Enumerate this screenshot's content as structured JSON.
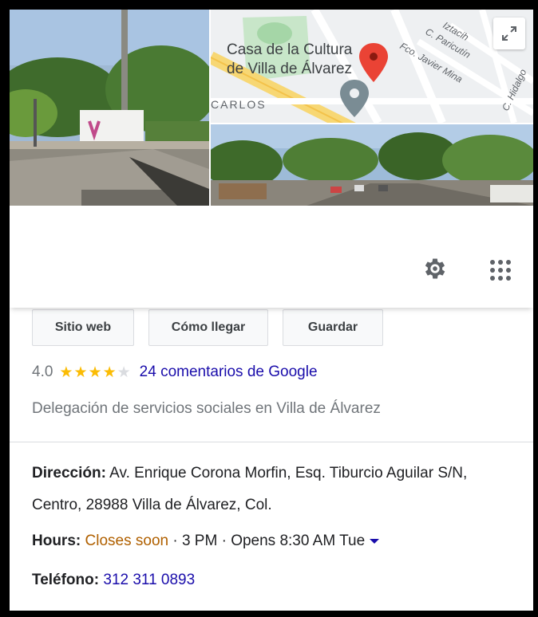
{
  "map": {
    "place_label_line1": "Casa de la Cultura",
    "place_label_line2": "de Villa de Álvarez",
    "street_carlos": "CARLOS",
    "street_iztacihuatl": "Iztacih",
    "street_paricutin": "C. Paricutín",
    "street_javier_mina": "Fco. Javier Mina",
    "street_hidalgo": "C. Hidalgo"
  },
  "actions": [
    {
      "label": "Sitio web"
    },
    {
      "label": "Cómo llegar"
    },
    {
      "label": "Guardar"
    }
  ],
  "rating": {
    "value": "4.0",
    "stars_filled": 4,
    "stars_total": 5,
    "reviews_text": "24 comentarios de Google"
  },
  "category": "Delegación de servicios sociales en Villa de Álvarez",
  "address": {
    "label": "Dirección:",
    "value": "Av. Enrique Corona Morfin, Esq. Tiburcio Aguilar S/N, Centro, 28988 Villa de Álvarez, Col."
  },
  "hours": {
    "label": "Hours:",
    "status": "Closes soon",
    "close_time": " · 3 PM · Opens 8:30 AM Tue"
  },
  "phone": {
    "label": "Teléfono:",
    "value": "312 311 0893"
  },
  "colors": {
    "star": "#fbbc04",
    "link": "#1a0dab",
    "closes_soon": "#b06000",
    "pin": "#ea4335"
  }
}
